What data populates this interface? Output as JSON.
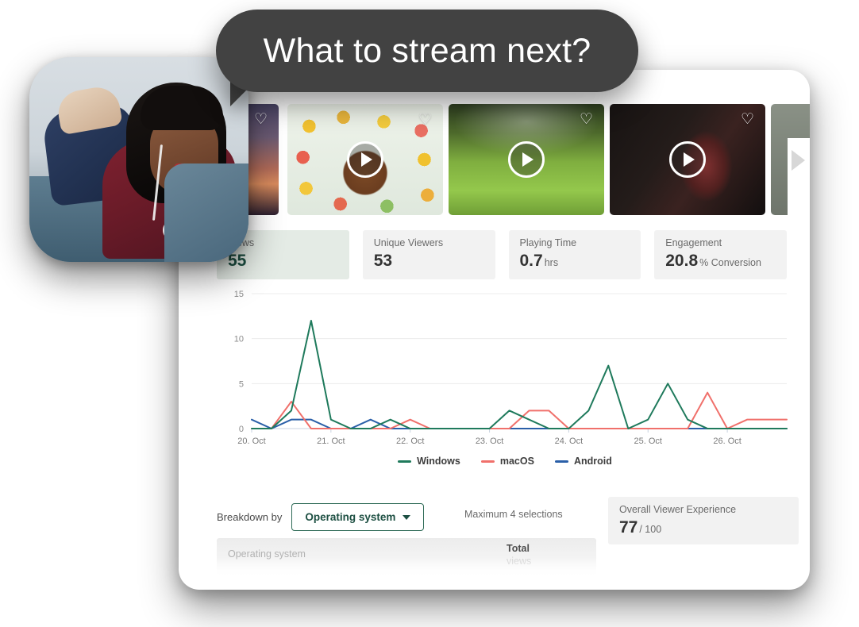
{
  "speech_bubble": {
    "text": "What to stream next?"
  },
  "user_photo": {
    "alt": "Woman lying on couch looking at smartphone with earphones"
  },
  "carousel": {
    "next_icon": "chevron-right-icon",
    "items": [
      {
        "id": "thumb-0",
        "favorite_icon": "heart-outline-icon",
        "play_icon": "play-circle-icon",
        "alt": "Sunset silhouette"
      },
      {
        "id": "thumb-1",
        "favorite_icon": "heart-outline-icon",
        "play_icon": "play-circle-icon",
        "alt": "Man with glasses surrounded by colorful cereal rings"
      },
      {
        "id": "thumb-2",
        "favorite_icon": "heart-outline-icon",
        "play_icon": "play-circle-icon",
        "alt": "Children lying in green grass field with guitar"
      },
      {
        "id": "thumb-3",
        "favorite_icon": "heart-outline-icon",
        "play_icon": "play-circle-icon",
        "alt": "Person in red plaid shirt in dark room"
      },
      {
        "id": "thumb-4",
        "favorite_icon": "heart-outline-icon",
        "play_icon": "play-circle-icon",
        "alt": "Next video"
      }
    ]
  },
  "stats": [
    {
      "label": "Views",
      "value": "55",
      "unit": "",
      "highlight": true
    },
    {
      "label": "Unique Viewers",
      "value": "53",
      "unit": "",
      "highlight": false
    },
    {
      "label": "Playing Time",
      "value": "0.7",
      "unit": "hrs",
      "highlight": false
    },
    {
      "label": "Engagement",
      "value": "20.8",
      "unit": "% Conversion",
      "highlight": false
    }
  ],
  "chart_data": {
    "type": "line",
    "title": "",
    "xlabel": "",
    "ylabel": "",
    "ylim": [
      0,
      15
    ],
    "yticks": [
      0,
      5,
      10,
      15
    ],
    "grid": true,
    "legend_position": "bottom",
    "x_tick_labels": [
      "20. Oct",
      "21. Oct",
      "22. Oct",
      "23. Oct",
      "24. Oct",
      "25. Oct",
      "26. Oct"
    ],
    "x": [
      "20. Oct",
      "20. Oct +6h",
      "20. Oct +12h",
      "20. Oct +18h",
      "21. Oct",
      "21. Oct +6h",
      "21. Oct +12h",
      "21. Oct +18h",
      "22. Oct",
      "22. Oct +6h",
      "22. Oct +12h",
      "22. Oct +18h",
      "23. Oct",
      "23. Oct +6h",
      "23. Oct +12h",
      "23. Oct +18h",
      "24. Oct",
      "24. Oct +6h",
      "24. Oct +12h",
      "24. Oct +18h",
      "25. Oct",
      "25. Oct +6h",
      "25. Oct +12h",
      "25. Oct +18h",
      "26. Oct",
      "26. Oct +6h",
      "26. Oct +12h",
      "26. Oct +18h"
    ],
    "series": [
      {
        "name": "Windows",
        "color": "#1f7a5c",
        "values": [
          0,
          0,
          2,
          12,
          1,
          0,
          0,
          1,
          0,
          0,
          0,
          0,
          0,
          2,
          1,
          0,
          0,
          2,
          7,
          0,
          1,
          5,
          1,
          0,
          0,
          0,
          0,
          0
        ]
      },
      {
        "name": "macOS",
        "color": "#f0706b",
        "values": [
          0,
          0,
          3,
          0,
          0,
          0,
          0,
          0,
          1,
          0,
          0,
          0,
          0,
          0,
          2,
          2,
          0,
          0,
          0,
          0,
          0,
          0,
          0,
          4,
          0,
          1,
          1,
          1
        ]
      },
      {
        "name": "Android",
        "color": "#2a5fa8",
        "values": [
          1,
          0,
          1,
          1,
          0,
          0,
          1,
          0,
          0,
          0,
          0,
          0,
          0,
          0,
          0,
          0,
          0,
          0,
          0,
          0,
          0,
          0,
          0,
          0,
          0,
          0,
          0,
          0
        ]
      }
    ]
  },
  "breakdown": {
    "label": "Breakdown by",
    "selected": "Operating system",
    "chevron_icon": "chevron-down-icon",
    "max_selections_note": "Maximum 4 selections",
    "table": {
      "columns": [
        "Operating system",
        "Total",
        "views"
      ]
    }
  },
  "viewer_experience": {
    "label": "Overall Viewer Experience",
    "score": "77",
    "out_of": "/ 100"
  },
  "colors": {
    "windows": "#1f7a5c",
    "macos": "#f0706b",
    "android": "#2a5fa8",
    "accent_green": "#1d4f42",
    "card_bg": "#f2f2f2",
    "card_highlight_bg": "#e4ebe5",
    "bubble_bg": "#424242"
  }
}
